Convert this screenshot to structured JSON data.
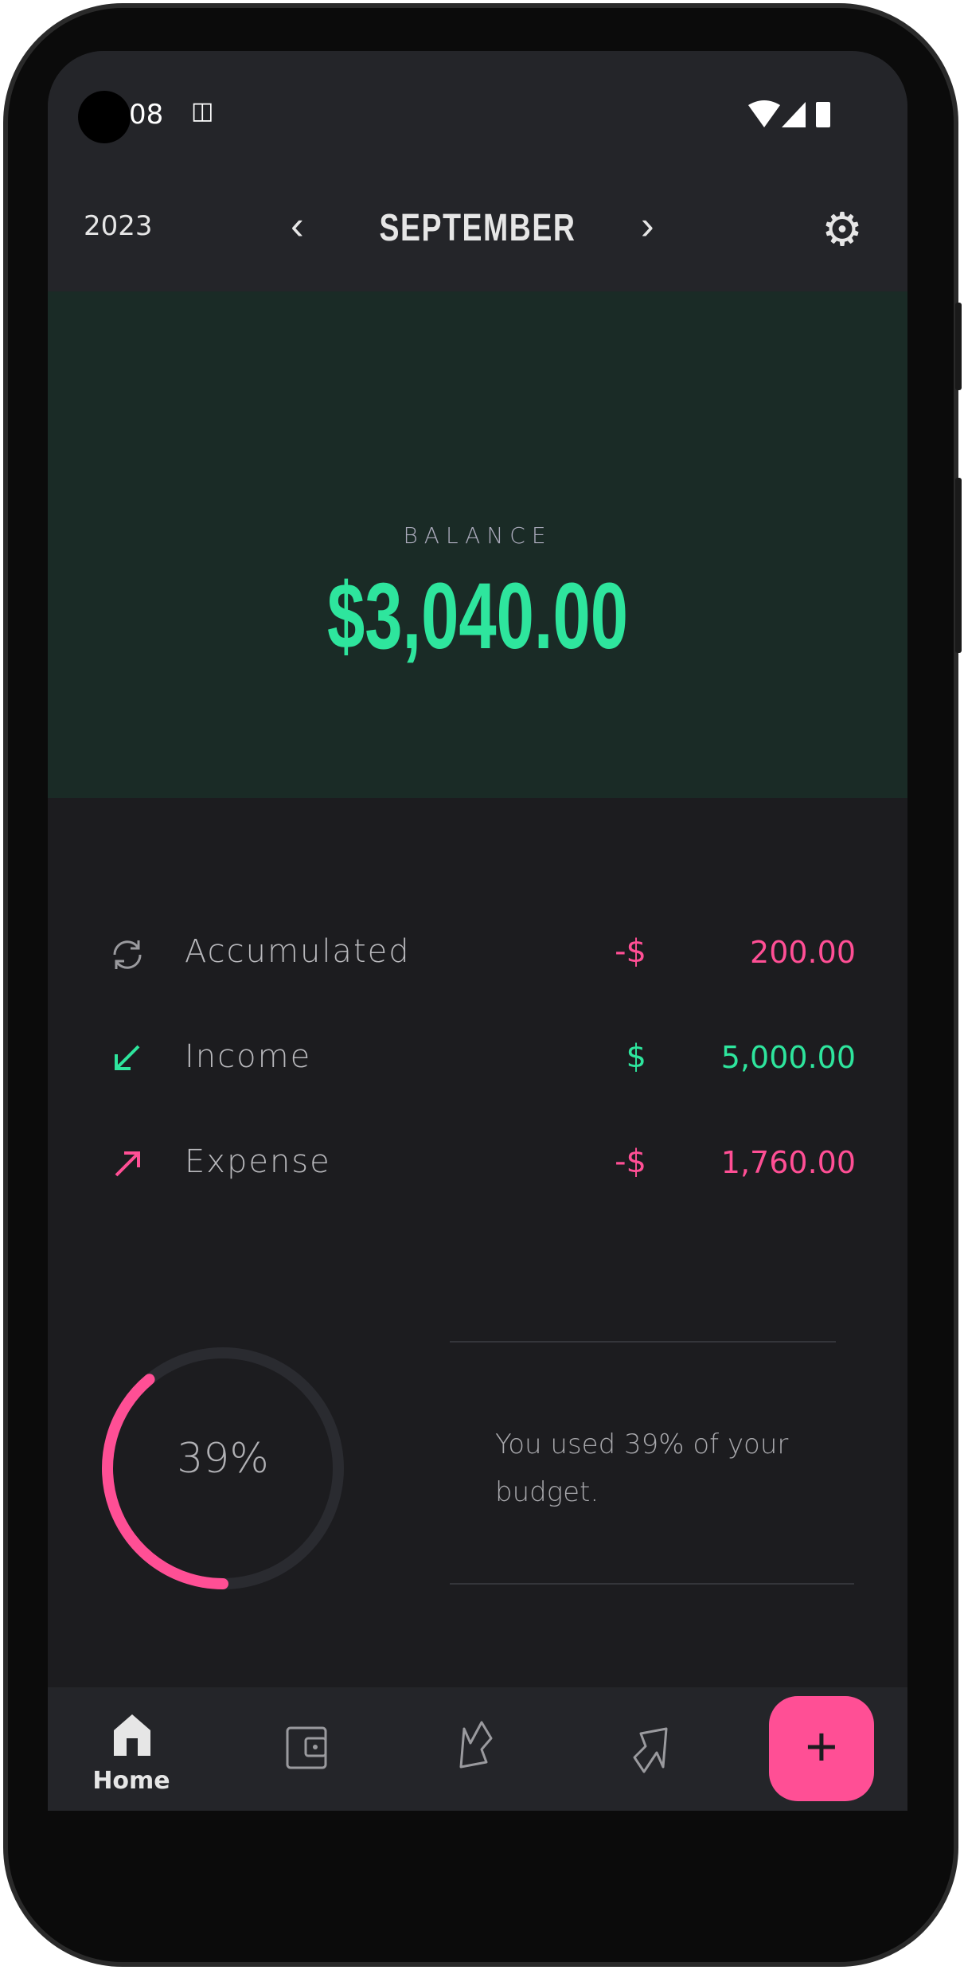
{
  "status_bar": {
    "time": "08",
    "notification_icon": "android-debug-icon",
    "icons": [
      "wifi-icon",
      "signal-icon",
      "battery-icon"
    ]
  },
  "header": {
    "year": "2023",
    "month": "SEPTEMBER",
    "prev_icon": "chevron-left-icon",
    "next_icon": "chevron-right-icon",
    "settings_icon": "gear-icon"
  },
  "balance": {
    "label": "BALANCE",
    "value": "$3,040.00"
  },
  "summary": [
    {
      "label": "Accumulated",
      "currency": "-$",
      "amount": "200.00",
      "icon": "sync-icon",
      "color": "#ff4f95"
    },
    {
      "label": "Income",
      "currency": "$",
      "amount": "5,000.00",
      "icon": "arrow-down-left-icon",
      "color": "#2ee59d"
    },
    {
      "label": "Expense",
      "currency": "-$",
      "amount": "1,760.00",
      "icon": "arrow-up-right-icon",
      "color": "#ff4f95"
    }
  ],
  "budget": {
    "percent_label": "39%",
    "percent": 39,
    "message": "You used 39% of your budget."
  },
  "bottom_nav": {
    "items": [
      {
        "label": "Home",
        "icon": "home-icon",
        "active": true
      },
      {
        "icon": "wallet-icon"
      },
      {
        "icon": "income-arrow-icon"
      },
      {
        "icon": "expense-arrow-icon"
      }
    ],
    "fab_label": "+"
  },
  "colors": {
    "accent_green": "#2ee59d",
    "accent_pink": "#ff4f95"
  }
}
